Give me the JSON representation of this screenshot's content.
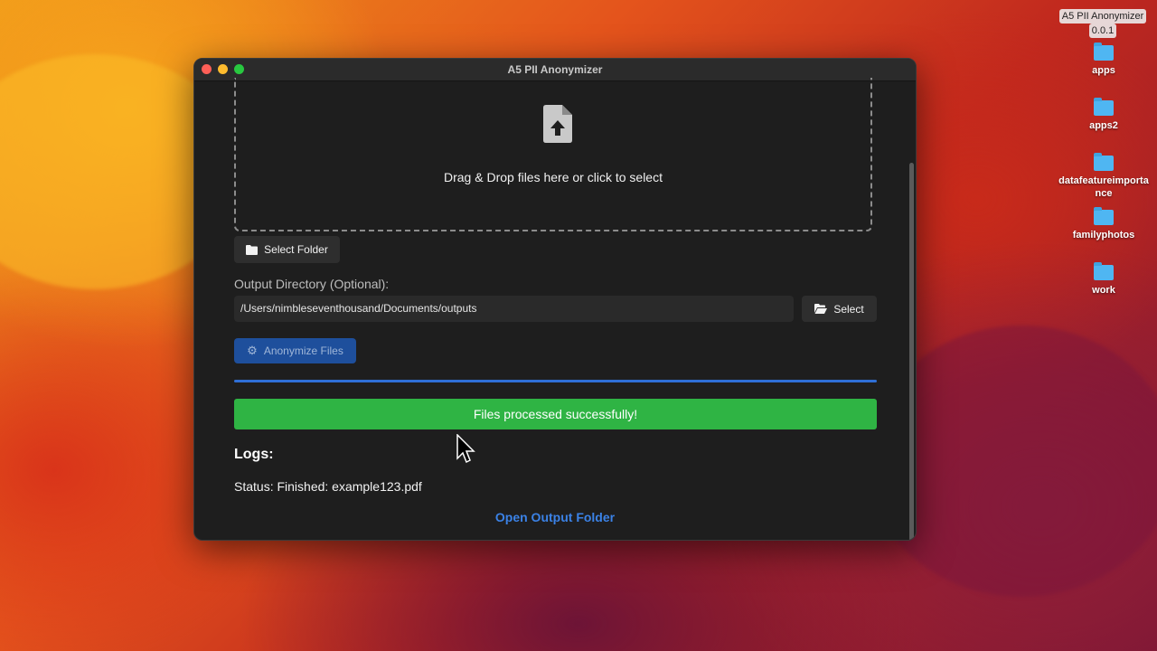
{
  "desktop": {
    "menubar_app": {
      "name": "A5 PII Anonymizer",
      "version": "0.0.1"
    },
    "folders": [
      "apps",
      "apps2",
      "datafeatureimportance",
      "familyphotos",
      "work"
    ]
  },
  "window": {
    "title": "A5 PII Anonymizer",
    "dropzone": {
      "text": "Drag & Drop files here or click to select"
    },
    "select_folder_label": "Select Folder",
    "output": {
      "label": "Output Directory (Optional):",
      "value": "/Users/nimbleseventhousand/Documents/outputs",
      "select_label": "Select"
    },
    "anonymize_label": "Anonymize Files",
    "progress_percent": 100,
    "success_message": "Files processed successfully!",
    "logs_heading": "Logs:",
    "status_text": "Status: Finished: example123.pdf",
    "open_output_label": "Open Output Folder"
  },
  "colors": {
    "accent": "#2f6fd6",
    "success": "#2fb444",
    "link": "#3b82e6"
  }
}
